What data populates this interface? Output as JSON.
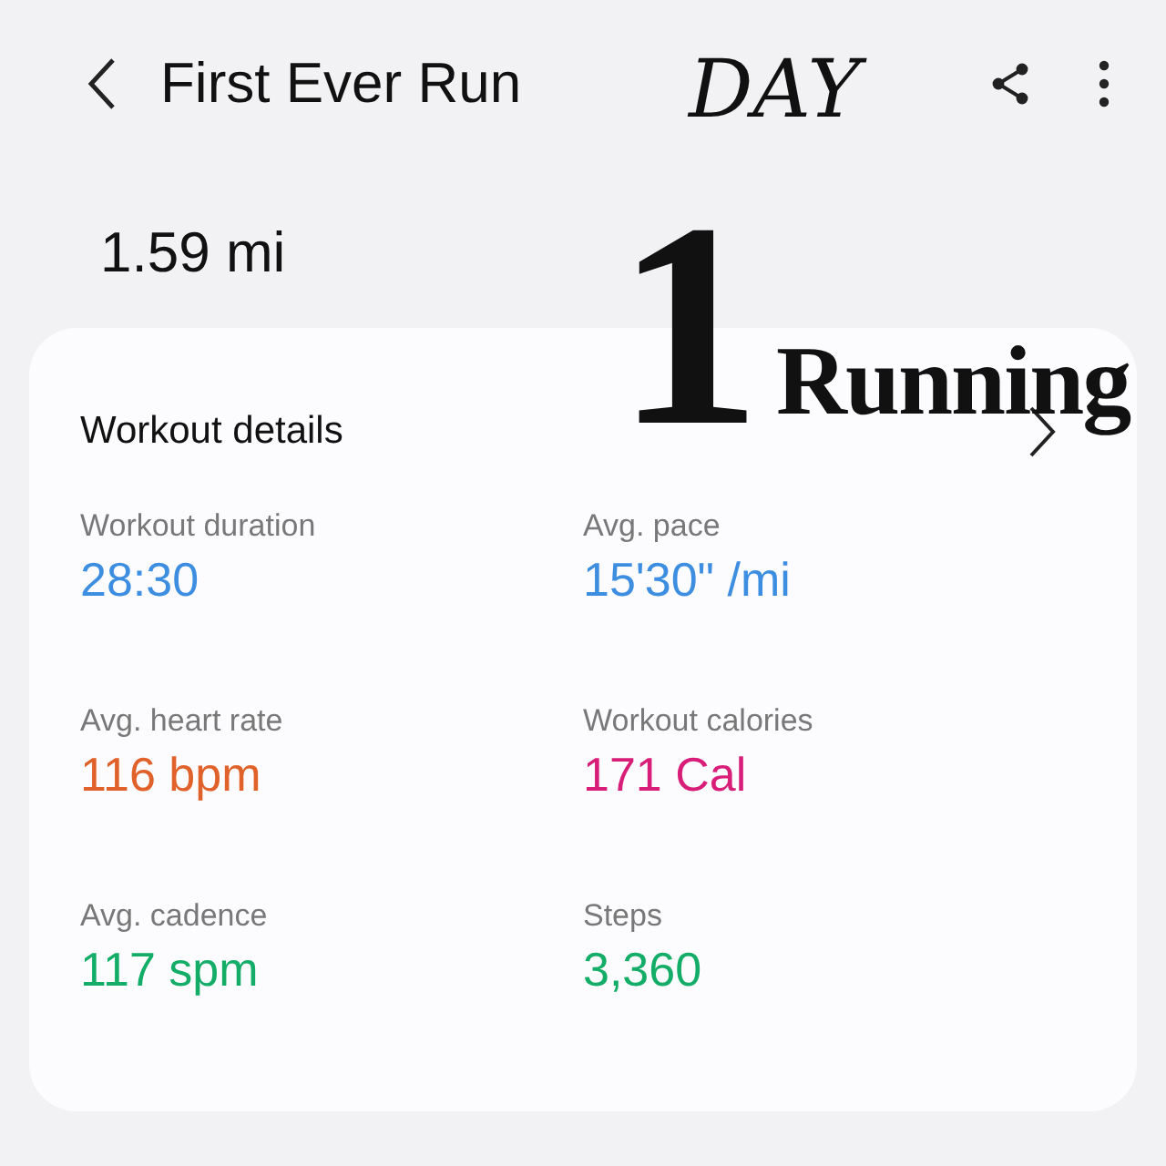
{
  "header": {
    "title": "First Ever Run"
  },
  "distance": "1.59 mi",
  "details": {
    "title": "Workout details",
    "metrics": [
      {
        "label": "Workout duration",
        "value": "28:30",
        "color": "#3d8ee0"
      },
      {
        "label": "Avg. pace",
        "value": "15'30\" /mi",
        "color": "#3d8ee0"
      },
      {
        "label": "Avg. heart rate",
        "value": "116 bpm",
        "color": "#e0622a"
      },
      {
        "label": "Workout calories",
        "value": "171 Cal",
        "color": "#d81e78"
      },
      {
        "label": "Avg. cadence",
        "value": "117 spm",
        "color": "#14ad68"
      },
      {
        "label": "Steps",
        "value": "3,360",
        "color": "#14ad68"
      }
    ]
  },
  "overlay": [
    {
      "kind": "script",
      "text": "DAY"
    },
    {
      "kind": "numeral",
      "text": "1"
    },
    {
      "kind": "headline",
      "text": "Running"
    }
  ]
}
